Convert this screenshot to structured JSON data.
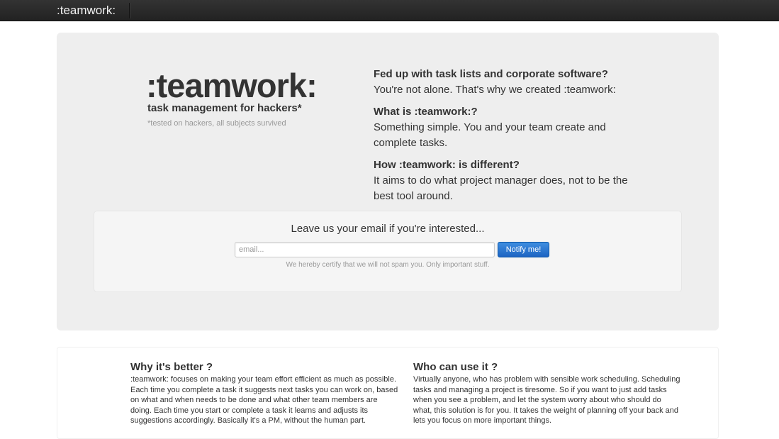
{
  "navbar": {
    "brand": ":teamwork:"
  },
  "hero": {
    "logo": ":teamwork:",
    "tagline": "task management for hackers*",
    "footnote": "*tested on hackers, all subjects survived",
    "qa": [
      {
        "question": "Fed up with task lists and corporate software?",
        "answer": "You're not alone. That's why we created :teamwork:"
      },
      {
        "question": "What is :teamwork:?",
        "answer": "Something simple. You and your team create and complete tasks."
      },
      {
        "question": "How :teamwork: is different?",
        "answer": "It aims to do what project manager does, not to be the best tool around."
      }
    ]
  },
  "signup": {
    "heading": "Leave us your email if you're interested...",
    "email_placeholder": "email...",
    "email_value": "",
    "button_label": "Notify me!",
    "note": "We hereby certify that we will not spam you. Only important stuff."
  },
  "features": [
    {
      "title": "Why it's better ?",
      "body": ":teamwork: focuses on making your team effort efficient as much as possible. Each time you complete a task it suggests next tasks you can work on, based on what and when needs to be done and what other team members are doing. Each time you start or complete a task it learns and adjusts its suggestions accordingly. Basically it's a PM, without the human part."
    },
    {
      "title": "Who can use it ?",
      "body": "Virtually anyone, who has problem with sensible work scheduling. Scheduling tasks and managing a project is tiresome. So if you want to just add tasks when you see a problem, and let the system worry about who should do what, this solution is for you. It takes the weight of planning off your back and lets you focus on more important things."
    }
  ]
}
